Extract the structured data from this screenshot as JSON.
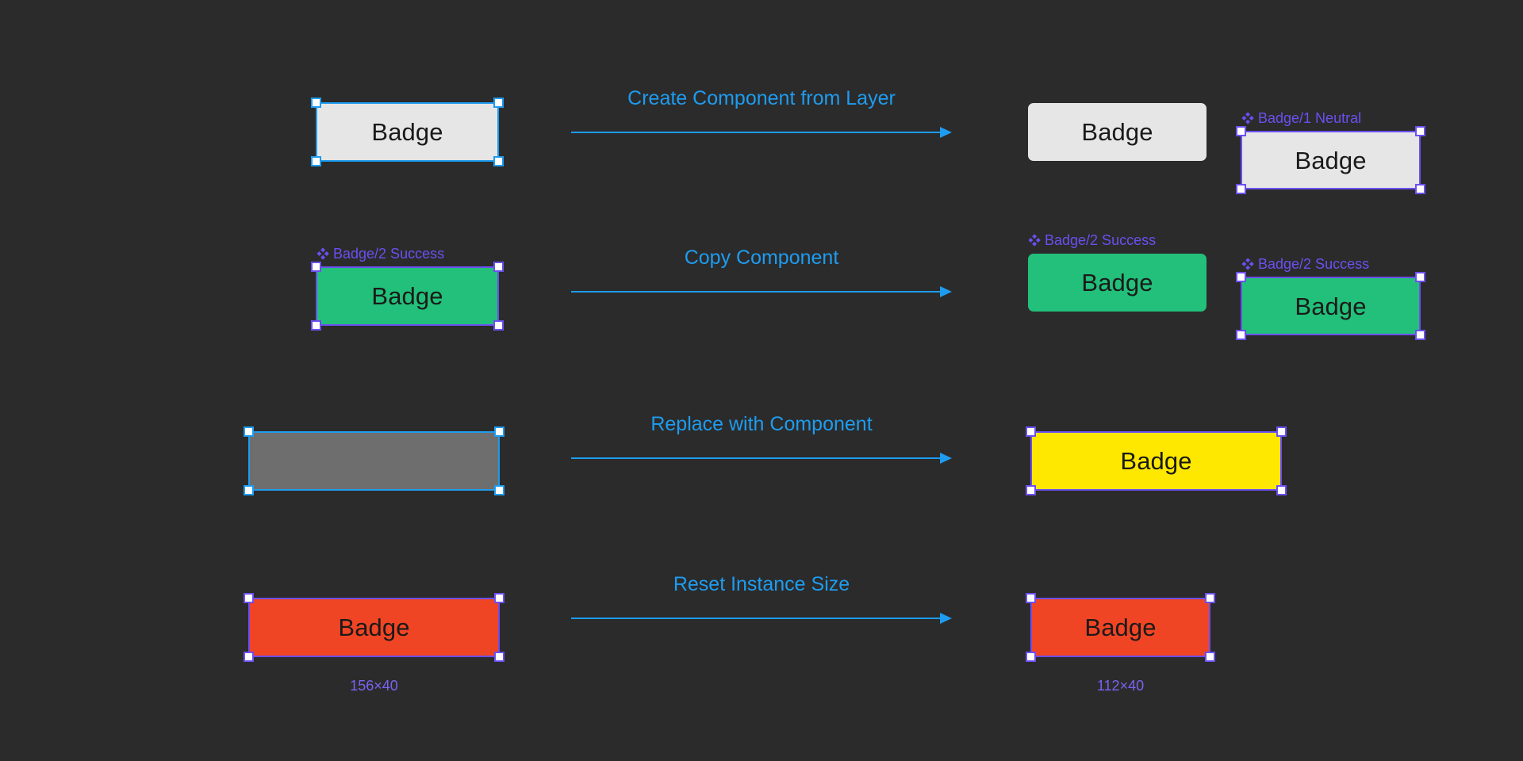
{
  "canvas": {
    "background": "#2b2b2b",
    "selection_blue": "#1e9cf0",
    "selection_purple": "#6c4ff0",
    "component_label_color": "#6c4ff0",
    "arrow_color": "#1e9cf0"
  },
  "icons": {
    "component": "component-diamond-icon"
  },
  "rows": [
    {
      "id": "create-component-from-layer",
      "arrow": {
        "caption": "Create Component from Layer"
      },
      "before": {
        "badge_text": "Badge",
        "fill": "#e6e6e6",
        "selection": "blue",
        "component_label": null,
        "dimension": null
      },
      "after_plain": {
        "badge_text": "Badge",
        "fill": "#e6e6e6",
        "selection": "none",
        "component_label": null,
        "dimension": null
      },
      "after_component": {
        "badge_text": "Badge",
        "fill": "#e6e6e6",
        "selection": "purple",
        "component_label": "Badge/1 Neutral",
        "dimension": null
      }
    },
    {
      "id": "copy-component",
      "arrow": {
        "caption": "Copy Component"
      },
      "before": {
        "badge_text": "Badge",
        "fill": "#22c07a",
        "selection": "purple",
        "component_label": "Badge/2 Success",
        "dimension": null
      },
      "after_plain": {
        "badge_text": "Badge",
        "fill": "#22c07a",
        "selection": "none",
        "component_label": "Badge/2 Success",
        "dimension": null
      },
      "after_component": {
        "badge_text": "Badge",
        "fill": "#22c07a",
        "selection": "purple",
        "component_label": "Badge/2 Success",
        "dimension": null
      }
    },
    {
      "id": "replace-with-component",
      "arrow": {
        "caption": "Replace with Component"
      },
      "before": {
        "badge_text": "",
        "fill": "#6e6e6e",
        "selection": "blue",
        "component_label": null,
        "dimension": null
      },
      "after_plain": null,
      "after_component": {
        "badge_text": "Badge",
        "fill": "#ffe800",
        "selection": "purple",
        "component_label": null,
        "dimension": null
      }
    },
    {
      "id": "reset-instance-size",
      "arrow": {
        "caption": "Reset Instance Size"
      },
      "before": {
        "badge_text": "Badge",
        "fill": "#f04524",
        "selection": "purple",
        "component_label": null,
        "dimension": "156×40"
      },
      "after_plain": null,
      "after_component": {
        "badge_text": "Badge",
        "fill": "#f04524",
        "selection": "purple",
        "component_label": null,
        "dimension": "112×40"
      }
    }
  ]
}
